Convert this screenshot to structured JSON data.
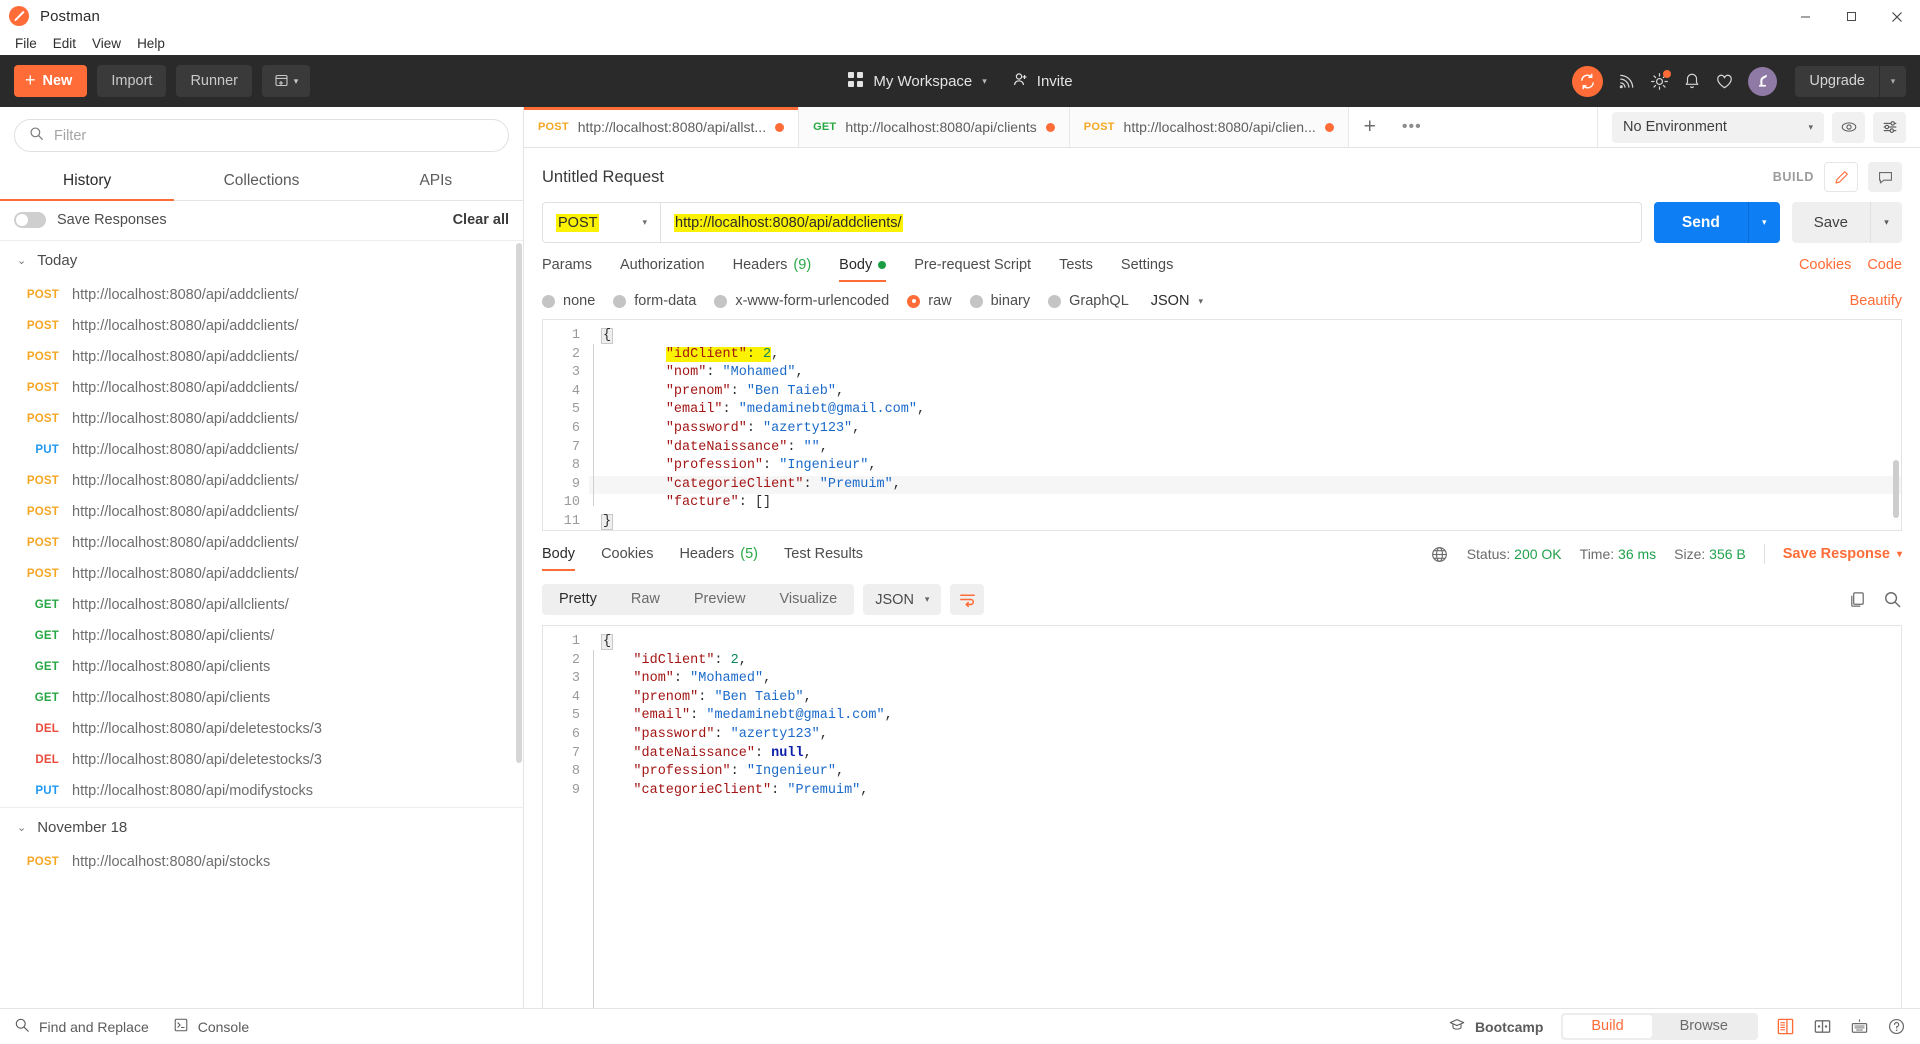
{
  "titlebar": {
    "app_name": "Postman",
    "logo_icon": "postman-logo-icon",
    "minimize": "─",
    "maximize": "□",
    "close": "✕"
  },
  "menubar": {
    "items": [
      {
        "label": "File"
      },
      {
        "label": "Edit"
      },
      {
        "label": "View"
      },
      {
        "label": "Help"
      }
    ]
  },
  "header": {
    "new_button": {
      "label": "New",
      "plus": "+"
    },
    "import_button": "Import",
    "runner_button": "Runner",
    "new_window_icon": "new-window-icon",
    "workspace": {
      "label": "My Workspace",
      "grid_icon": "grid-icon",
      "caret": "▾"
    },
    "invite": {
      "label": "Invite",
      "icon": "invite-person-icon"
    },
    "sync_icon": "sync-icon",
    "antenna_icon": "antenna-icon",
    "settings_icon": "gear-icon",
    "notifications_icon": "bell-icon",
    "favorites_icon": "heart-icon",
    "avatar_icon": "user-avatar-icon",
    "upgrade": {
      "label": "Upgrade",
      "caret": "▾"
    }
  },
  "sidebar": {
    "filter": {
      "placeholder": "Filter",
      "value": "",
      "icon": "search-icon"
    },
    "tabs": [
      {
        "label": "History",
        "active": true
      },
      {
        "label": "Collections",
        "active": false
      },
      {
        "label": "APIs",
        "active": false
      }
    ],
    "save_responses": {
      "label": "Save Responses",
      "on": false
    },
    "clear_all": "Clear all",
    "groups": [
      {
        "title": "Today",
        "chevron": "⌄",
        "items": [
          {
            "method": "POST",
            "url": "http://localhost:8080/api/addclients/"
          },
          {
            "method": "POST",
            "url": "http://localhost:8080/api/addclients/"
          },
          {
            "method": "POST",
            "url": "http://localhost:8080/api/addclients/"
          },
          {
            "method": "POST",
            "url": "http://localhost:8080/api/addclients/"
          },
          {
            "method": "POST",
            "url": "http://localhost:8080/api/addclients/"
          },
          {
            "method": "PUT",
            "url": "http://localhost:8080/api/addclients/"
          },
          {
            "method": "POST",
            "url": "http://localhost:8080/api/addclients/"
          },
          {
            "method": "POST",
            "url": "http://localhost:8080/api/addclients/"
          },
          {
            "method": "POST",
            "url": "http://localhost:8080/api/addclients/"
          },
          {
            "method": "POST",
            "url": "http://localhost:8080/api/addclients/"
          },
          {
            "method": "GET",
            "url": "http://localhost:8080/api/allclients/"
          },
          {
            "method": "GET",
            "url": "http://localhost:8080/api/clients/"
          },
          {
            "method": "GET",
            "url": "http://localhost:8080/api/clients"
          },
          {
            "method": "GET",
            "url": "http://localhost:8080/api/clients"
          },
          {
            "method": "DEL",
            "url": "http://localhost:8080/api/deletestocks/3"
          },
          {
            "method": "DEL",
            "url": "http://localhost:8080/api/deletestocks/3"
          },
          {
            "method": "PUT",
            "url": "http://localhost:8080/api/modifystocks"
          }
        ]
      },
      {
        "title": "November 18",
        "chevron": "⌄",
        "items": [
          {
            "method": "POST",
            "url": "http://localhost:8080/api/stocks"
          }
        ]
      }
    ]
  },
  "request_tabs": {
    "tabs": [
      {
        "method": "POST",
        "url": "http://localhost:8080/api/allst...",
        "unsaved": true,
        "active": true
      },
      {
        "method": "GET",
        "url": "http://localhost:8080/api/clients",
        "unsaved": true,
        "active": false
      },
      {
        "method": "POST",
        "url": "http://localhost:8080/api/clien...",
        "unsaved": true,
        "active": false
      }
    ],
    "add_tab": "+",
    "more_tabs": "•••",
    "environment": {
      "value": "No Environment",
      "caret": "▾"
    },
    "eye_icon": "eye-icon",
    "sliders_icon": "sliders-icon"
  },
  "request": {
    "title": "Untitled Request",
    "build_label": "BUILD",
    "edit_icon": "pencil-icon",
    "comment_icon": "comment-icon",
    "method": "POST",
    "method_caret": "▾",
    "url": "http://localhost:8080/api/addclients/",
    "send_label": "Send",
    "send_caret": "▾",
    "save_label": "Save",
    "save_caret": "▾",
    "tabs": [
      {
        "label": "Params",
        "active": false
      },
      {
        "label": "Authorization",
        "active": false
      },
      {
        "label": "Headers",
        "count": "(9)",
        "active": false
      },
      {
        "label": "Body",
        "dot": true,
        "active": true
      },
      {
        "label": "Pre-request Script",
        "active": false
      },
      {
        "label": "Tests",
        "active": false
      },
      {
        "label": "Settings",
        "active": false
      }
    ],
    "cookies_link": "Cookies",
    "code_link": "Code",
    "body_types": [
      {
        "label": "none",
        "selected": false
      },
      {
        "label": "form-data",
        "selected": false
      },
      {
        "label": "x-www-form-urlencoded",
        "selected": false
      },
      {
        "label": "raw",
        "selected": true
      },
      {
        "label": "binary",
        "selected": false
      },
      {
        "label": "GraphQL",
        "selected": false
      }
    ],
    "format": {
      "value": "JSON",
      "caret": "▾"
    },
    "beautify": "Beautify",
    "body_lines": [
      {
        "n": "1",
        "indent": 0
      },
      {
        "n": "2",
        "indent": 2,
        "key": "idClient",
        "value": "2",
        "type": "number",
        "comma": true,
        "highlight": true
      },
      {
        "n": "3",
        "indent": 2,
        "key": "nom",
        "value": "Mohamed",
        "type": "string",
        "comma": true
      },
      {
        "n": "4",
        "indent": 2,
        "key": "prenom",
        "value": "Ben Taieb",
        "type": "string",
        "comma": true
      },
      {
        "n": "5",
        "indent": 2,
        "key": "email",
        "value": "medaminebt@gmail.com",
        "type": "string",
        "comma": true
      },
      {
        "n": "6",
        "indent": 2,
        "key": "password",
        "value": "azerty123",
        "type": "string",
        "comma": true
      },
      {
        "n": "7",
        "indent": 2,
        "key": "dateNaissance",
        "value": "",
        "type": "string",
        "comma": true
      },
      {
        "n": "8",
        "indent": 2,
        "key": "profession",
        "value": "Ingenieur",
        "type": "string",
        "comma": true
      },
      {
        "n": "9",
        "indent": 2,
        "key": "categorieClient",
        "value": "Premuim",
        "type": "string",
        "comma": true,
        "row_highlight": true
      },
      {
        "n": "10",
        "indent": 2,
        "key": "facture",
        "value": "[]",
        "type": "raw",
        "comma": false
      },
      {
        "n": "11",
        "indent": 0
      }
    ],
    "open_brace": "{",
    "close_brace": "}"
  },
  "response": {
    "tabs": [
      {
        "label": "Body",
        "active": true
      },
      {
        "label": "Cookies",
        "active": false
      },
      {
        "label": "Headers",
        "count": "(5)",
        "active": false
      },
      {
        "label": "Test Results",
        "active": false
      }
    ],
    "globe_icon": "globe-icon",
    "status_label": "Status:",
    "status_value": "200 OK",
    "time_label": "Time:",
    "time_value": "36 ms",
    "size_label": "Size:",
    "size_value": "356 B",
    "save_response": "Save Response",
    "save_response_caret": "▾",
    "view_modes": [
      {
        "label": "Pretty",
        "active": true
      },
      {
        "label": "Raw",
        "active": false
      },
      {
        "label": "Preview",
        "active": false
      },
      {
        "label": "Visualize",
        "active": false
      }
    ],
    "format": {
      "value": "JSON",
      "caret": "▾"
    },
    "wrap_icon": "word-wrap-icon",
    "copy_icon": "copy-icon",
    "search_icon": "search-icon",
    "body_lines": [
      {
        "n": "1",
        "indent": 0
      },
      {
        "n": "2",
        "indent": 1,
        "key": "idClient",
        "value": "2",
        "type": "number",
        "comma": true
      },
      {
        "n": "3",
        "indent": 1,
        "key": "nom",
        "value": "Mohamed",
        "type": "string",
        "comma": true
      },
      {
        "n": "4",
        "indent": 1,
        "key": "prenom",
        "value": "Ben Taieb",
        "type": "string",
        "comma": true
      },
      {
        "n": "5",
        "indent": 1,
        "key": "email",
        "value": "medaminebt@gmail.com",
        "type": "string",
        "comma": true
      },
      {
        "n": "6",
        "indent": 1,
        "key": "password",
        "value": "azerty123",
        "type": "string",
        "comma": true
      },
      {
        "n": "7",
        "indent": 1,
        "key": "dateNaissance",
        "value": "null",
        "type": "null",
        "comma": true
      },
      {
        "n": "8",
        "indent": 1,
        "key": "profession",
        "value": "Ingenieur",
        "type": "string",
        "comma": true
      },
      {
        "n": "9",
        "indent": 1,
        "key": "categorieClient",
        "value": "Premuim",
        "type": "string",
        "comma": true
      }
    ],
    "open_brace": "{"
  },
  "footer": {
    "find_replace": {
      "label": "Find and Replace",
      "icon": "search-icon"
    },
    "console": {
      "label": "Console",
      "icon": "console-icon"
    },
    "bootcamp": {
      "label": "Bootcamp",
      "icon": "graduation-cap-icon"
    },
    "modes": [
      {
        "label": "Build",
        "active": true
      },
      {
        "label": "Browse",
        "active": false
      }
    ],
    "two_pane_icon": "two-pane-layout-icon",
    "split_icon": "split-layout-icon",
    "keyboard_icon": "keyboard-icon",
    "help_icon": "help-icon"
  },
  "colors": {
    "accent": "#ff6c37",
    "send_blue": "#0d7ef4",
    "success_green": "#21a14c",
    "highlight_yellow": "#faf200",
    "header_dark": "#2a2a2a"
  }
}
